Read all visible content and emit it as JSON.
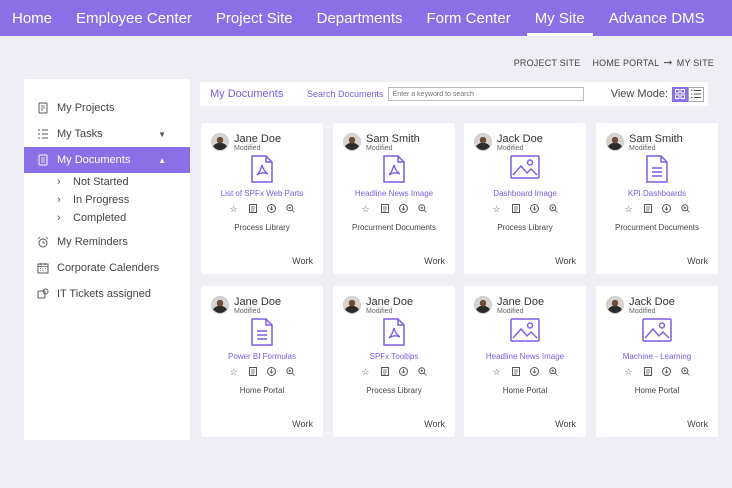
{
  "nav": {
    "items": [
      "Home",
      "Employee Center",
      "Project Site",
      "Departments",
      "Form Center",
      "My Site",
      "Advance DMS"
    ],
    "active_index": 5
  },
  "breadcrumb": {
    "items": [
      "PROJECT SITE",
      "HOME PORTAL",
      "MY SITE"
    ],
    "separator_icon": "arrow-right-icon"
  },
  "sidebar": {
    "items": [
      {
        "label": "My Projects",
        "icon": "projects-icon"
      },
      {
        "label": "My Tasks",
        "icon": "tasks-icon"
      },
      {
        "label": "My Documents",
        "icon": "documents-icon"
      },
      {
        "label": "My Reminders",
        "icon": "alarm-icon"
      },
      {
        "label": "Corporate Calenders",
        "icon": "calendar-icon"
      },
      {
        "label": "IT Tickets assigned",
        "icon": "tickets-icon"
      }
    ],
    "sub_items": [
      "Not Started",
      "In Progress",
      "Completed"
    ]
  },
  "toolbar": {
    "title": "My Documents",
    "search_label": "Search Documents",
    "search_placeholder": "Enter a keyword to search",
    "view_mode_label": "View Mode:"
  },
  "colors": {
    "accent": "#8b6fe6",
    "link": "#7c5ce0"
  },
  "cards": [
    {
      "owner": "Jane Doe",
      "status": "Modified",
      "type": "pdf",
      "title": "List of SPFx Web Parts",
      "location": "Process Library",
      "tag": "Work"
    },
    {
      "owner": "Sam Smith",
      "status": "Modified",
      "type": "pdf",
      "title": "Headline News Image",
      "location": "Procurment Documents",
      "tag": "Work"
    },
    {
      "owner": "Jack Doe",
      "status": "Modified",
      "type": "image",
      "title": "Dashboard Image",
      "location": "Process Library",
      "tag": "Work"
    },
    {
      "owner": "Sam Smith",
      "status": "Modified",
      "type": "doc",
      "title": "KPI Dashboards",
      "location": "Procurment Documents",
      "tag": "Work"
    },
    {
      "owner": "Jane Doe",
      "status": "Modified",
      "type": "doc",
      "title": "Power BI Formulas",
      "location": "Home Portal",
      "tag": "Work"
    },
    {
      "owner": "Jane Doe",
      "status": "Modified",
      "type": "pdf",
      "title": "SPFx Tooltips",
      "location": "Process Library",
      "tag": "Work"
    },
    {
      "owner": "Jane Doe",
      "status": "Modified",
      "type": "image",
      "title": "Headline News Image",
      "location": "Home Portal",
      "tag": "Work"
    },
    {
      "owner": "Jack Doe",
      "status": "Modified",
      "type": "image",
      "title": "Machine - Learning",
      "location": "Home Portal",
      "tag": "Work"
    }
  ]
}
